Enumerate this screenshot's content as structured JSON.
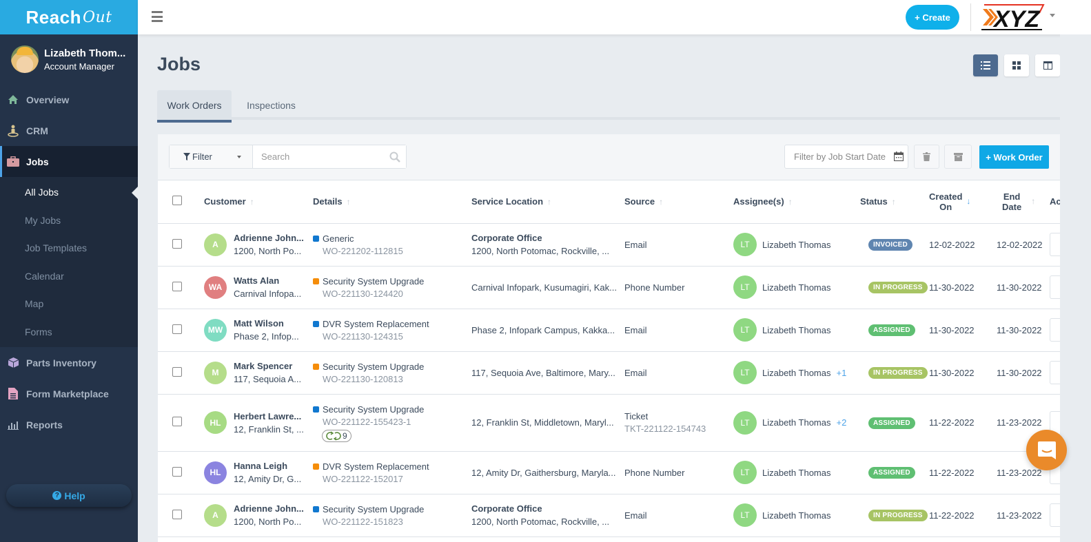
{
  "app": {
    "brand_main": "Reach",
    "brand_script": "Out"
  },
  "user": {
    "name": "Lizabeth Thom...",
    "role": "Account Manager"
  },
  "sidebar": {
    "items": [
      {
        "label": "Overview",
        "icon": "home-icon",
        "color": "#7fb89a"
      },
      {
        "label": "CRM",
        "icon": "person-pin-icon",
        "color": "#d6c38f"
      },
      {
        "label": "Jobs",
        "icon": "briefcase-icon",
        "color": "#d49aa0",
        "active": true
      },
      {
        "label": "Parts Inventory",
        "icon": "box-icon",
        "color": "#b8a6d9"
      },
      {
        "label": "Form Marketplace",
        "icon": "form-icon",
        "color": "#e3a3c2"
      },
      {
        "label": "Reports",
        "icon": "bar-chart-icon",
        "color": "#a9b5c4"
      }
    ],
    "jobs_subitems": [
      "All Jobs",
      "My Jobs",
      "Job Templates",
      "Calendar",
      "Map",
      "Forms"
    ],
    "active_subitem": "All Jobs",
    "help_label": "Help"
  },
  "topbar": {
    "create_label": "+ Create",
    "company_logo": "XYZ"
  },
  "page": {
    "title": "Jobs",
    "view_modes": [
      "list-view",
      "grid-view",
      "board-view"
    ],
    "active_view": "list-view",
    "tabs": [
      {
        "label": "Work Orders",
        "active": true
      },
      {
        "label": "Inspections",
        "active": false
      }
    ]
  },
  "toolbar": {
    "filter_label": "Filter",
    "search_placeholder": "Search",
    "date_filter_placeholder": "Filter by Job Start Date",
    "work_order_label": "+ Work Order"
  },
  "table": {
    "columns": [
      "Customer",
      "Details",
      "Service Location",
      "Source",
      "Assignee(s)",
      "Status",
      "Created On",
      "End Date",
      "Ac"
    ],
    "created_on_lines": [
      "Created",
      "On"
    ],
    "end_date_lines": [
      "End",
      "Date"
    ],
    "rows": [
      {
        "initials": "A",
        "avatar_color": "#b5dd8a",
        "name": "Adrienne John...",
        "address": "1200, North Po...",
        "job_type": "Generic",
        "type_color": "#1178cf",
        "wo": "WO-221202-112815",
        "recurrence": null,
        "loc_title": "Corporate Office",
        "loc": "1200, North Potomac, Rockville, ...",
        "source": "Email",
        "source_sub": null,
        "assignee": "Lizabeth Thomas",
        "assignee_initials": "LT",
        "extra": null,
        "status": "INVOICED",
        "status_color": "#5f85b0",
        "created": "12-02-2022",
        "end": "12-02-2022"
      },
      {
        "initials": "WA",
        "avatar_color": "#e07f80",
        "name": "Watts Alan",
        "address": "Carnival Infopa...",
        "job_type": "Security System Upgrade",
        "type_color": "#f58d0a",
        "wo": "WO-221130-124420",
        "recurrence": null,
        "loc_title": null,
        "loc": "Carnival Infopark, Kusumagiri, Kak...",
        "source": "Phone Number",
        "source_sub": null,
        "assignee": "Lizabeth Thomas",
        "assignee_initials": "LT",
        "extra": null,
        "status": "IN PROGRESS",
        "status_color": "#a7c464",
        "created": "11-30-2022",
        "end": "11-30-2022"
      },
      {
        "initials": "MW",
        "avatar_color": "#7fdcc2",
        "name": "Matt Wilson",
        "address": "Phase 2, Infop...",
        "job_type": "DVR System Replacement",
        "type_color": "#1178cf",
        "wo": "WO-221130-124315",
        "recurrence": null,
        "loc_title": null,
        "loc": "Phase 2, Infopark Campus, Kakka...",
        "source": "Email",
        "source_sub": null,
        "assignee": "Lizabeth Thomas",
        "assignee_initials": "LT",
        "extra": null,
        "status": "ASSIGNED",
        "status_color": "#5fbf72",
        "created": "11-30-2022",
        "end": "11-30-2022"
      },
      {
        "initials": "M",
        "avatar_color": "#b5dd8a",
        "name": "Mark Spencer",
        "address": "117, Sequoia A...",
        "job_type": "Security System Upgrade",
        "type_color": "#f58d0a",
        "wo": "WO-221130-120813",
        "recurrence": null,
        "loc_title": null,
        "loc": "117, Sequoia Ave, Baltimore, Mary...",
        "source": "Email",
        "source_sub": null,
        "assignee": "Lizabeth Thomas",
        "assignee_initials": "LT",
        "extra": "+1",
        "status": "IN PROGRESS",
        "status_color": "#a7c464",
        "created": "11-30-2022",
        "end": "11-30-2022"
      },
      {
        "initials": "HL",
        "avatar_color": "#a7db84",
        "name": "Herbert Lawre...",
        "address": "12, Franklin St, ...",
        "job_type": "Security System Upgrade",
        "type_color": "#1178cf",
        "wo": "WO-221122-155423-1",
        "recurrence": "9",
        "loc_title": null,
        "loc": "12, Franklin St, Middletown, Maryl...",
        "source": "Ticket",
        "source_sub": "TKT-221122-154743",
        "assignee": "Lizabeth Thomas",
        "assignee_initials": "LT",
        "extra": "+2",
        "status": "ASSIGNED",
        "status_color": "#5fbf72",
        "created": "11-22-2022",
        "end": "11-23-2022"
      },
      {
        "initials": "HL",
        "avatar_color": "#8b84e0",
        "name": "Hanna Leigh",
        "address": "12, Amity Dr, G...",
        "job_type": "DVR System Replacement",
        "type_color": "#f58d0a",
        "wo": "WO-221122-152017",
        "recurrence": null,
        "loc_title": null,
        "loc": "12, Amity Dr, Gaithersburg, Maryla...",
        "source": "Phone Number",
        "source_sub": null,
        "assignee": "Lizabeth Thomas",
        "assignee_initials": "LT",
        "extra": null,
        "status": "ASSIGNED",
        "status_color": "#5fbf72",
        "created": "11-22-2022",
        "end": "11-23-2022"
      },
      {
        "initials": "A",
        "avatar_color": "#b5dd8a",
        "name": "Adrienne John...",
        "address": "1200, North Po...",
        "job_type": "Security System Upgrade",
        "type_color": "#1178cf",
        "wo": "WO-221122-151823",
        "recurrence": null,
        "loc_title": "Corporate Office",
        "loc": "1200, North Potomac, Rockville, ...",
        "source": "Email",
        "source_sub": null,
        "assignee": "Lizabeth Thomas",
        "assignee_initials": "LT",
        "extra": null,
        "status": "IN PROGRESS",
        "status_color": "#a7c464",
        "created": "11-22-2022",
        "end": "11-23-2022"
      }
    ]
  },
  "chat_widget": {
    "icon": "chat-icon",
    "color": "#ea8a2a"
  }
}
